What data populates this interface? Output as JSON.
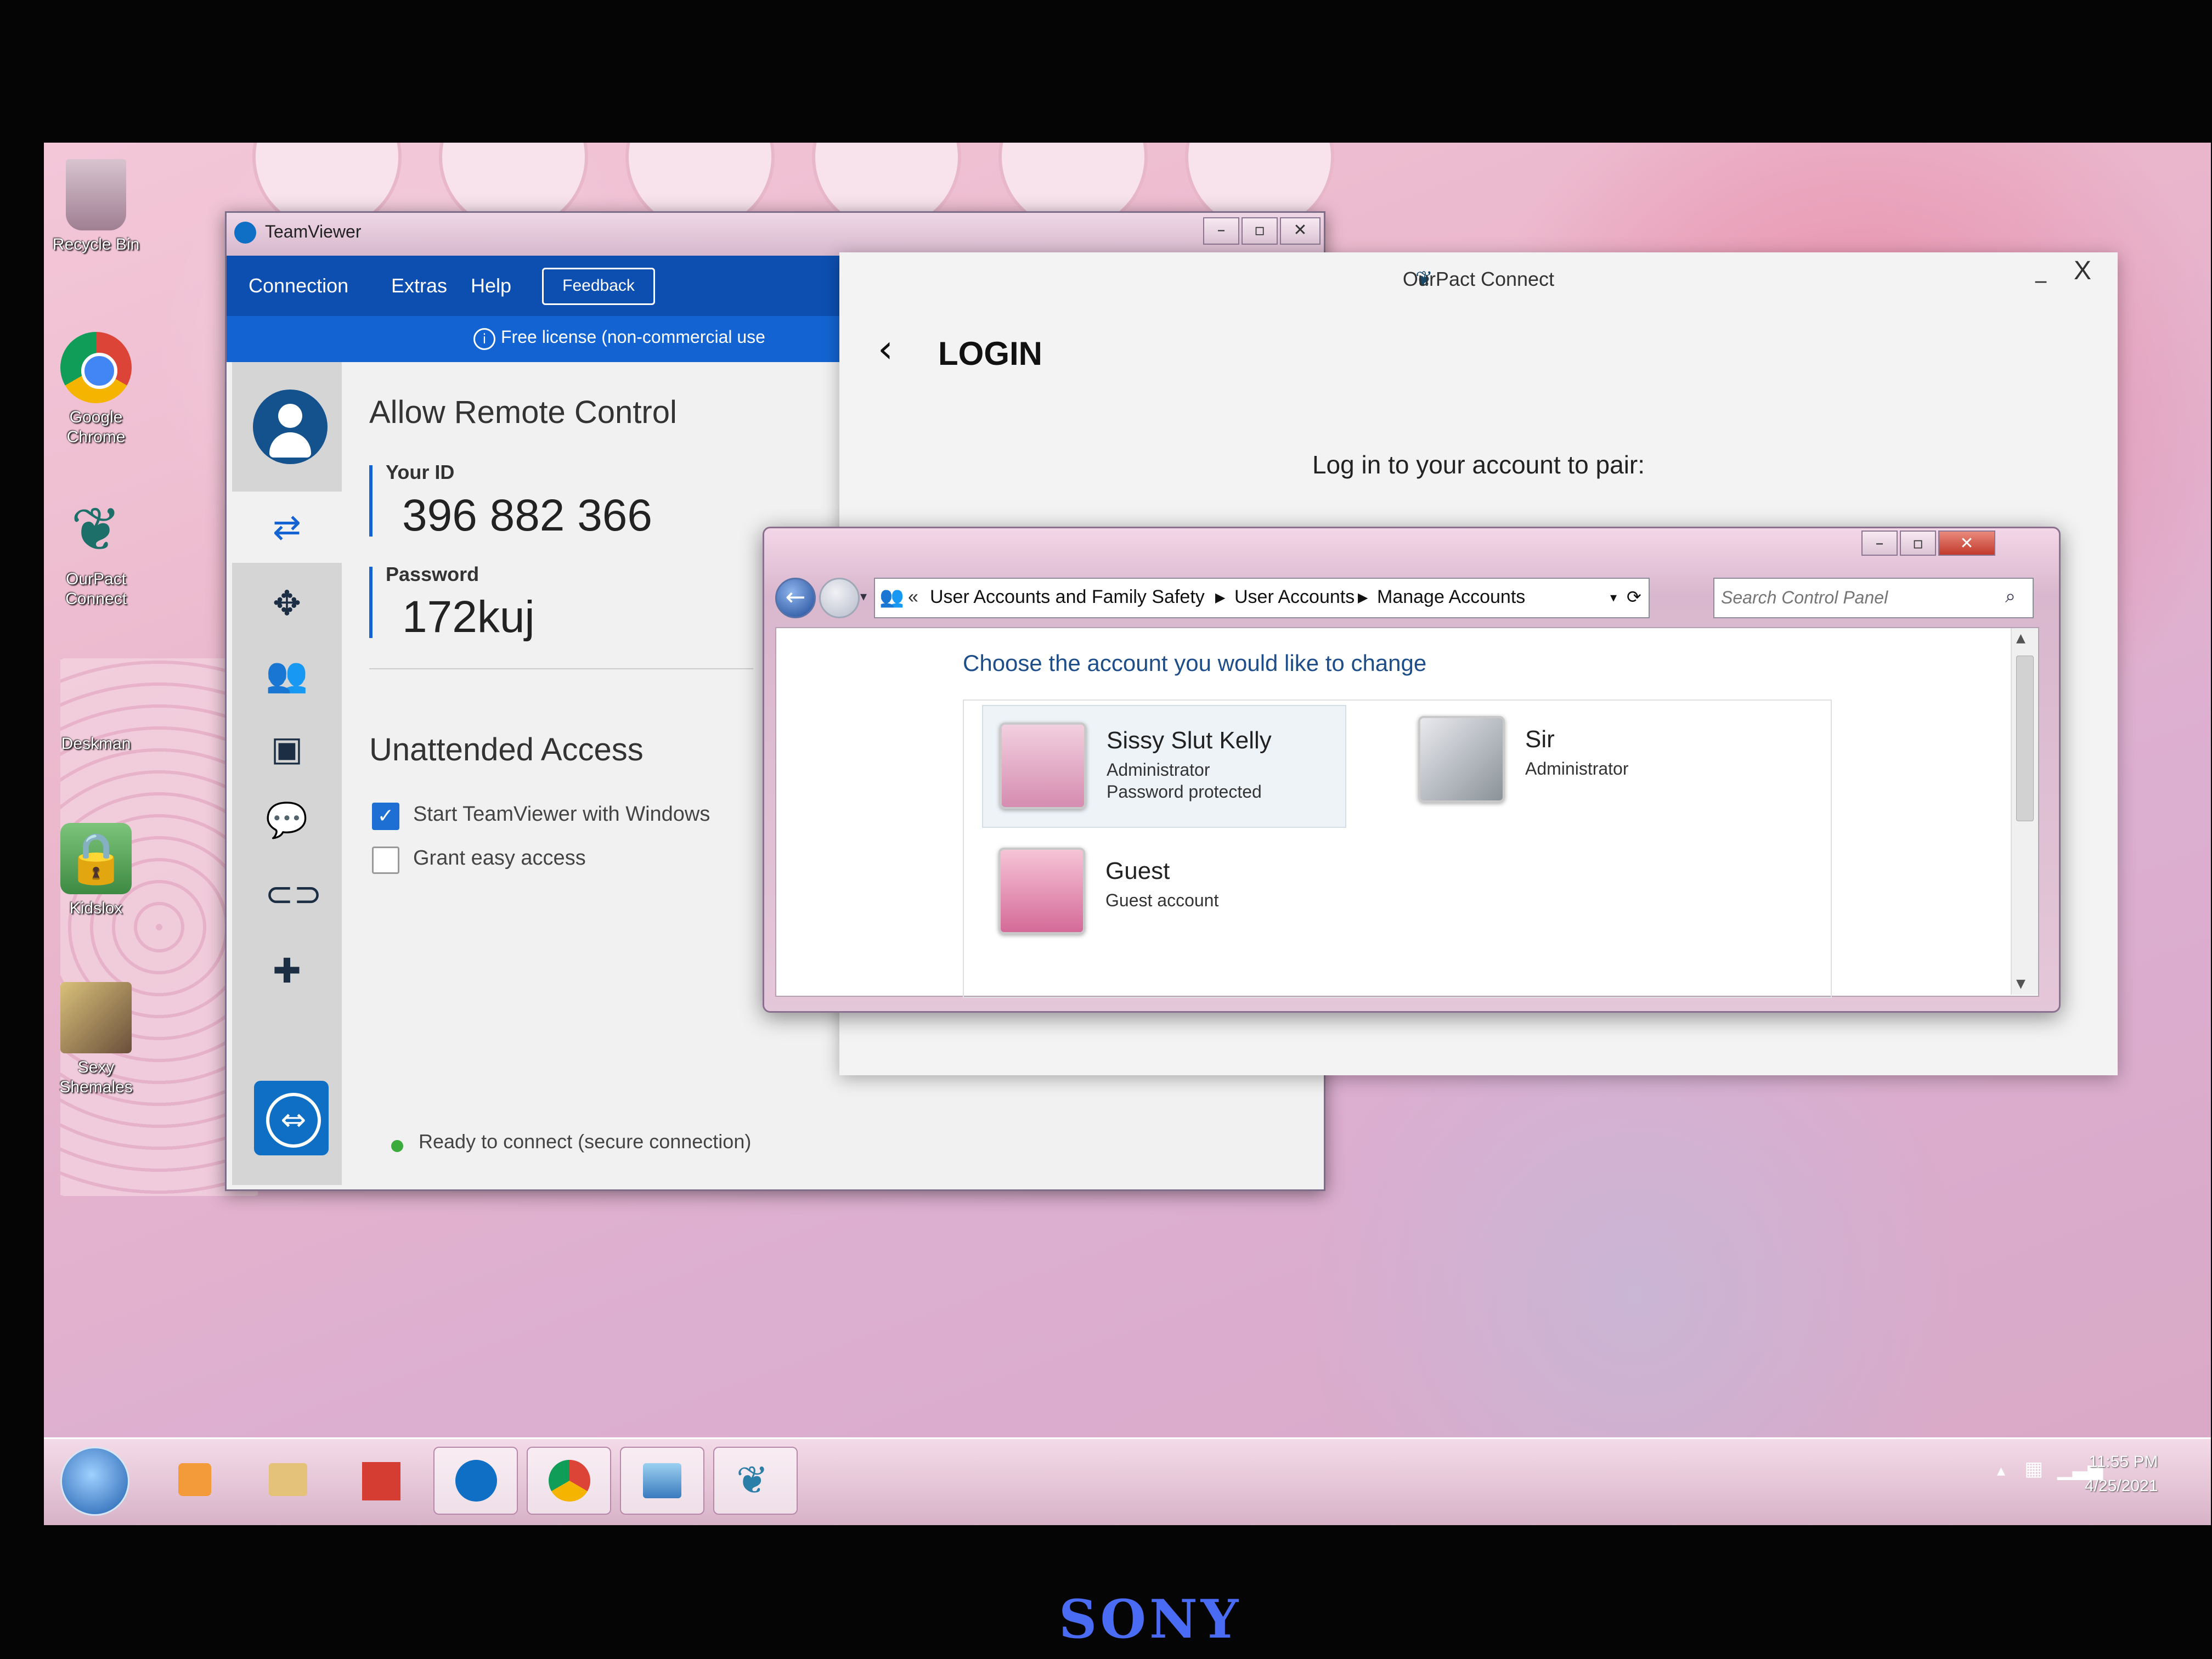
{
  "desktop": {
    "icons": [
      {
        "label": "Recycle Bin",
        "icon": "recycle-bin-icon"
      },
      {
        "label": "Google Chrome",
        "icon": "chrome-icon"
      },
      {
        "label": "OurPact Connect",
        "icon": "ourpact-icon"
      },
      {
        "label": "Deskman",
        "icon": "deskman-icon"
      },
      {
        "label": "Kidslox",
        "icon": "kidslox-lock-icon"
      },
      {
        "label": "Sexy Shemales",
        "icon": "folder-image-icon"
      }
    ]
  },
  "teamviewer": {
    "title": "TeamViewer",
    "menu": [
      "Connection",
      "Extras",
      "Help"
    ],
    "feedback_label": "Feedback",
    "license_notice": "Free license (non-commercial use",
    "allow_remote": {
      "heading": "Allow Remote Control",
      "id_label": "Your ID",
      "id_value": "396 882 366",
      "password_label": "Password",
      "password_value": "172kuj"
    },
    "unattended": {
      "heading": "Unattended Access",
      "options": [
        {
          "label": "Start TeamViewer with Windows",
          "checked": true
        },
        {
          "label": "Grant easy access",
          "checked": false
        }
      ]
    },
    "status": "Ready to connect (secure connection)",
    "accent_color": "#0e6fc5"
  },
  "ourpact": {
    "title": "OurPact Connect",
    "close_label": "X",
    "min_label": "_",
    "login_heading": "LOGIN",
    "prompt": "Log in to your account to pair:"
  },
  "control_panel": {
    "breadcrumb": [
      "User Accounts and Family Safety",
      "User Accounts",
      "Manage Accounts"
    ],
    "breadcrumb_prefix": "«",
    "search_placeholder": "Search Control Panel",
    "heading": "Choose the account you would like to change",
    "accounts": [
      {
        "name": "Sissy Slut Kelly",
        "role": "Administrator",
        "protection": "Password protected"
      },
      {
        "name": "Sir",
        "role": "Administrator",
        "protection": ""
      },
      {
        "name": "Guest",
        "role": "Guest account",
        "protection": ""
      }
    ]
  },
  "taskbar": {
    "time": "11:55 PM",
    "date": "4/25/2021"
  },
  "monitor": {
    "brand": "SONY"
  }
}
